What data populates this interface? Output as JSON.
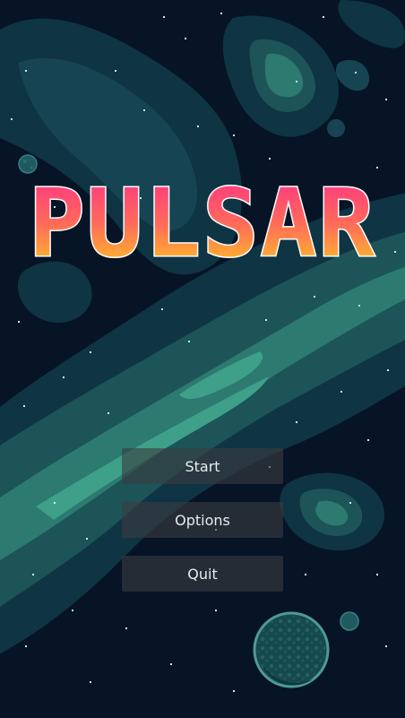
{
  "game": {
    "title": "PULSAR",
    "title_gradient": {
      "top": "#ff2e8c",
      "mid": "#ff6a5a",
      "bottom": "#ffd21a"
    },
    "title_outline": "#ffffff"
  },
  "menu": {
    "start_label": "Start",
    "options_label": "Options",
    "quit_label": "Quit"
  },
  "colors": {
    "space": "#061426",
    "nebula_dark": "#0f3443",
    "nebula_mid": "#1c5458",
    "nebula_light": "#2c7a70",
    "nebula_bright": "#3fa08a",
    "star": "#bff6ee",
    "button_bg": "#3a3c40",
    "button_text": "#e8ecee"
  }
}
